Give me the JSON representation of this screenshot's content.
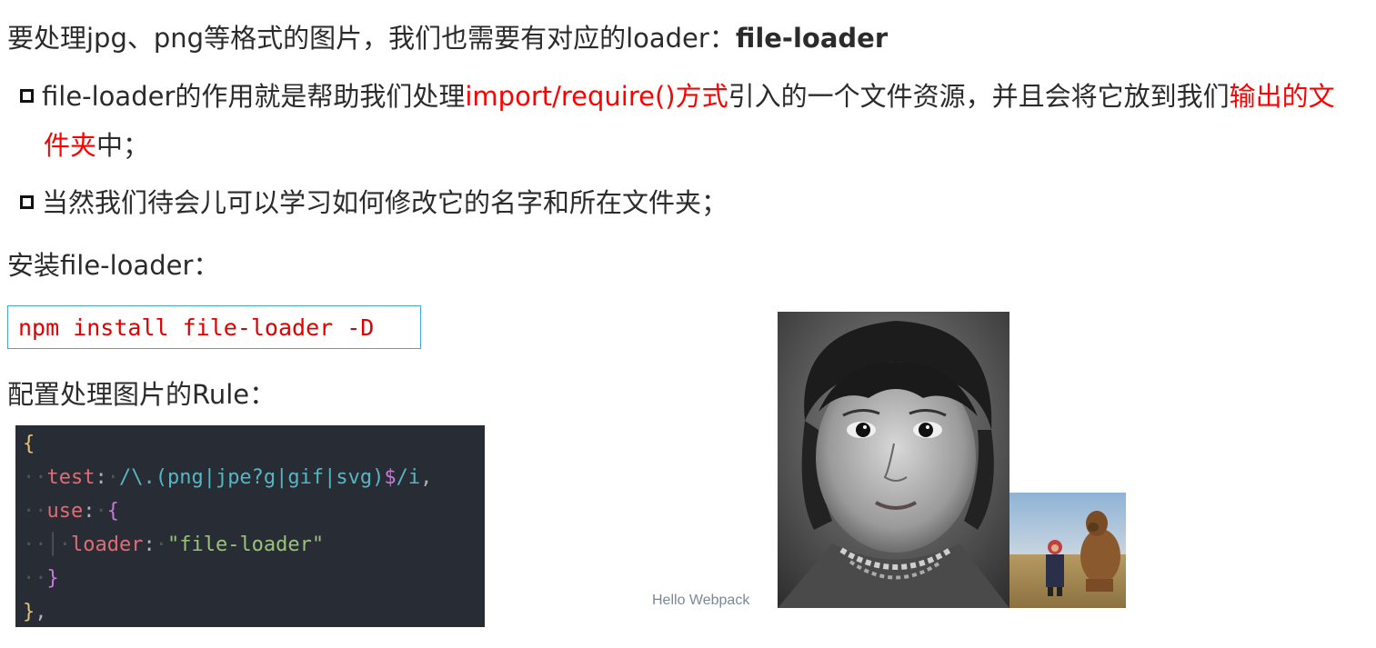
{
  "intro": {
    "text": "要处理jpg、png等格式的图片，我们也需要有对应的loader：",
    "bold": "file-loader"
  },
  "bullet1": {
    "part1": "file-loader的作用就是帮助我们处理",
    "red1": "import/require()方式",
    "part2": "引入的一个文件资源，并且会将它放到我们",
    "red2a": "输出的文",
    "red2b": "件夹",
    "part3": "中；"
  },
  "bullet2": {
    "text": "当然我们待会儿可以学习如何修改它的名字和所在文件夹；"
  },
  "install_heading": "安装file-loader：",
  "install_command": "npm install file-loader -D",
  "rule_heading": "配置处理图片的Rule：",
  "code": {
    "open_brace": "{",
    "test_key": "test",
    "colon": ":",
    "regex": "/\\.(png|jpe?g|gif|svg)",
    "regex_end": "$",
    "regex_flag": "/i",
    "comma": ",",
    "use_key": "use",
    "use_open": "{",
    "loader_key": "loader",
    "loader_value": "\"file-loader\"",
    "inner_close": "}",
    "close": "}",
    "close_comma": ","
  },
  "demo": {
    "caption": "Hello Webpack"
  },
  "colors": {
    "red_text": "#ff0000",
    "code_bg": "#282c34",
    "command_border": "#3fa9d6"
  }
}
